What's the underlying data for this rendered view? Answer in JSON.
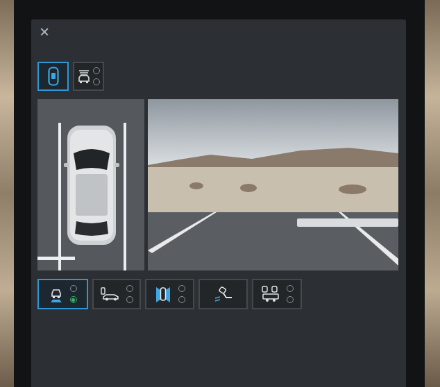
{
  "close": {
    "icon": "×"
  },
  "view_modes": [
    {
      "selected": true,
      "dots": []
    },
    {
      "selected": false,
      "dots": [
        {
          "on": false
        },
        {
          "on": false
        }
      ]
    }
  ],
  "camera_modes": [
    {
      "selected": true,
      "dots": [
        {
          "on": false
        },
        {
          "on": true
        }
      ]
    },
    {
      "selected": false,
      "dots": [
        {
          "on": false
        },
        {
          "on": false
        }
      ]
    },
    {
      "selected": false,
      "dots": [
        {
          "on": false
        },
        {
          "on": false
        }
      ]
    },
    {
      "selected": false,
      "dots": []
    },
    {
      "selected": false,
      "dots": [
        {
          "on": false
        },
        {
          "on": false
        }
      ]
    }
  ]
}
